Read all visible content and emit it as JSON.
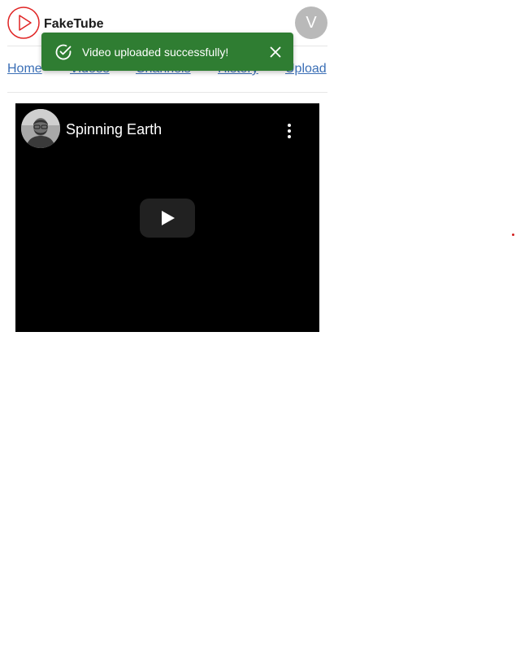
{
  "header": {
    "brand": "FakeTube",
    "avatar_letter": "V",
    "logo_icon": "play-circle-icon"
  },
  "nav": {
    "items": [
      {
        "label": "Home"
      },
      {
        "label": "Videos"
      },
      {
        "label": "Channels"
      },
      {
        "label": "History"
      },
      {
        "label": "Upload"
      }
    ]
  },
  "toast": {
    "message": "Video uploaded successfully!",
    "icon": "check-circle-icon",
    "close_icon": "close-icon",
    "color": "#2f7d32"
  },
  "player": {
    "title": "Spinning Earth",
    "menu_icon": "more-vert-icon",
    "play_icon": "play-icon"
  },
  "colors": {
    "brand_red": "#e02424",
    "link": "#3b6fb6"
  }
}
